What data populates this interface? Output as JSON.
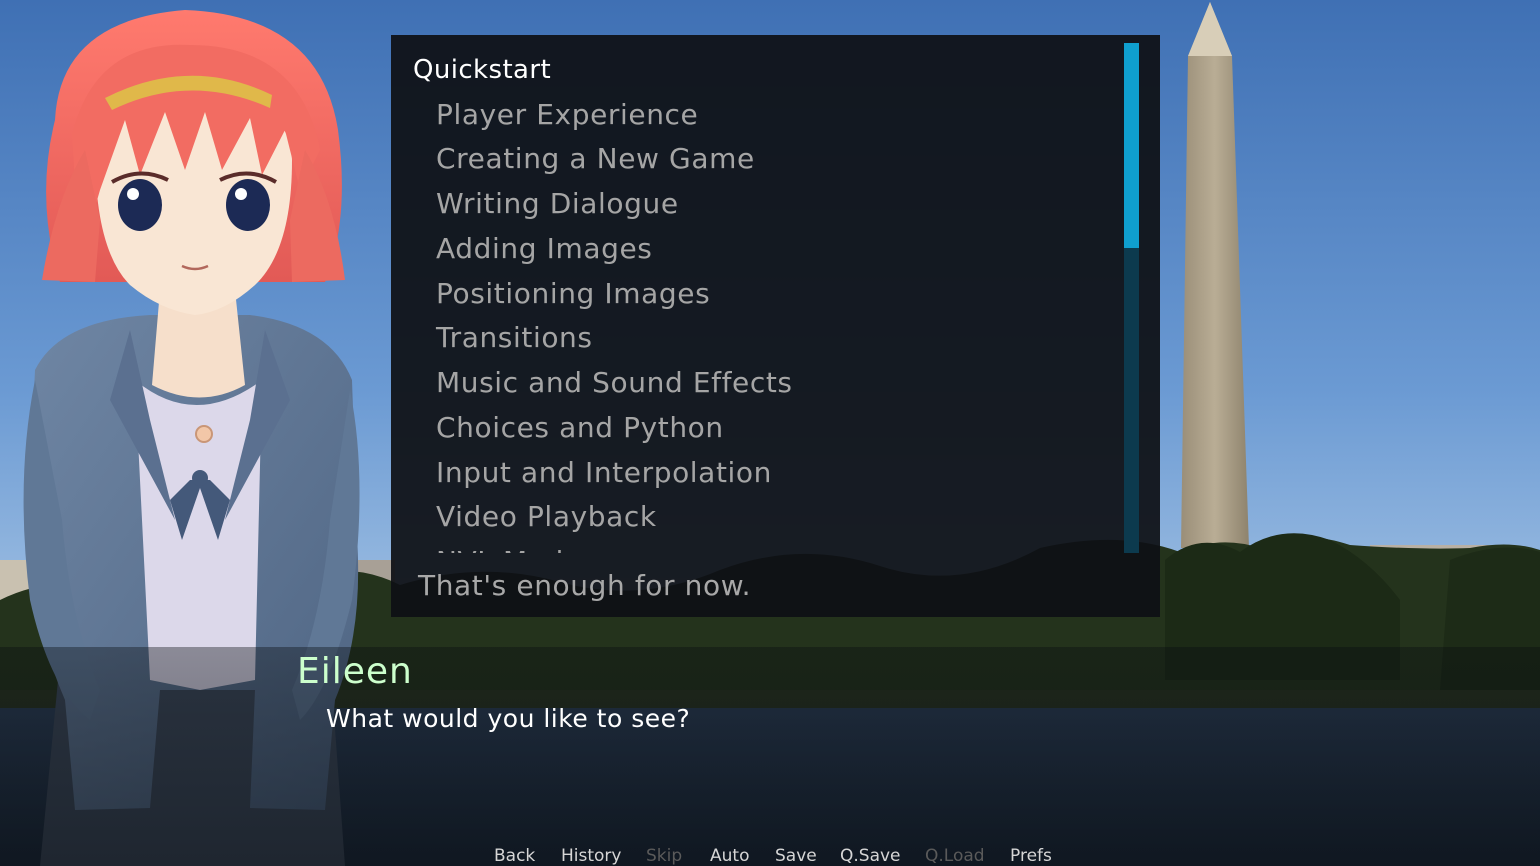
{
  "menu": {
    "heading": "Quickstart",
    "items": [
      "Player Experience",
      "Creating a New Game",
      "Writing Dialogue",
      "Adding Images",
      "Positioning Images",
      "Transitions",
      "Music and Sound Effects",
      "Choices and Python",
      "Input and Interpolation",
      "Video Playback",
      "NVL Mode"
    ],
    "exit_label": "That's enough for now.",
    "scroll_position": 0.0
  },
  "dialogue": {
    "speaker": "Eileen",
    "text": "What would you like to see?"
  },
  "quick_menu": {
    "back": "Back",
    "history": "History",
    "skip": "Skip",
    "auto": "Auto",
    "save": "Save",
    "qsave": "Q.Save",
    "qload": "Q.Load",
    "prefs": "Prefs"
  },
  "colors": {
    "speaker_name": "#ccffcc",
    "scrollbar_thumb": "#0f9fcf",
    "menu_text": "#a5a5a5"
  }
}
